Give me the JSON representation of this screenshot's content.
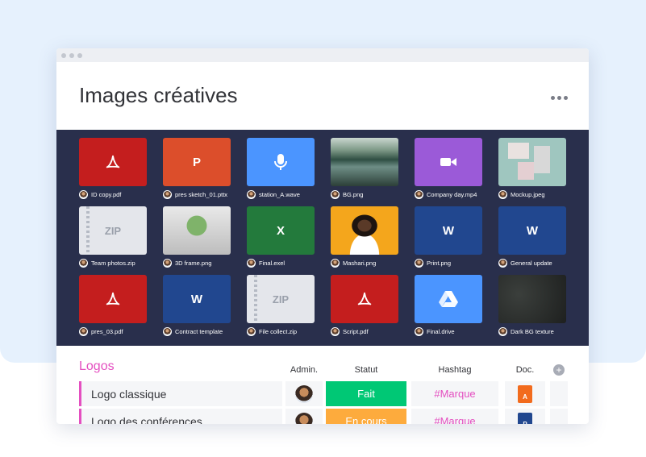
{
  "window": {
    "title": "Images créatives"
  },
  "gallery": {
    "items": [
      {
        "name": "ID copy.pdf",
        "type": "pdf",
        "glyph": "pdf-icon",
        "color": "#c41e1e"
      },
      {
        "name": "pres sketch_01.pttx",
        "type": "ppt",
        "glyph": "P",
        "color": "#dc4e2b"
      },
      {
        "name": "station_A.wave",
        "type": "audio",
        "glyph": "microphone-icon",
        "color": "#4b95ff"
      },
      {
        "name": "BG.png",
        "type": "image",
        "glyph": "lake-landscape-photo",
        "color": "#3f6f5d"
      },
      {
        "name": "Company day.mp4",
        "type": "video",
        "glyph": "video-camera-icon",
        "color": "#9b5ad8"
      },
      {
        "name": "Mockup.jpeg",
        "type": "image",
        "glyph": "mockup-photo",
        "color": "#9fc6bf"
      },
      {
        "name": "Team photos.zip",
        "type": "zip",
        "glyph": "ZIP",
        "color": "#e4e6eb"
      },
      {
        "name": "3D frame.png",
        "type": "image",
        "glyph": "3d-render-photo",
        "color": "#d9d9d9"
      },
      {
        "name": "Final.exel",
        "type": "excel",
        "glyph": "X",
        "color": "#237a3c"
      },
      {
        "name": "Mashari.png",
        "type": "image",
        "glyph": "portrait-photo",
        "color": "#f4a61c"
      },
      {
        "name": "Print.png",
        "type": "word",
        "glyph": "W",
        "color": "#21478f"
      },
      {
        "name": "General update",
        "type": "word",
        "glyph": "W",
        "color": "#21478f"
      },
      {
        "name": "pres_03.pdf",
        "type": "pdf",
        "glyph": "pdf-icon",
        "color": "#c41e1e"
      },
      {
        "name": "Contract template",
        "type": "word",
        "glyph": "W",
        "color": "#21478f"
      },
      {
        "name": "File collect.zip",
        "type": "zip",
        "glyph": "ZIP",
        "color": "#e4e6eb"
      },
      {
        "name": "Script.pdf",
        "type": "pdf",
        "glyph": "pdf-icon",
        "color": "#c41e1e"
      },
      {
        "name": "Final.drive",
        "type": "drive",
        "glyph": "drive-icon",
        "color": "#4b95ff"
      },
      {
        "name": "Dark BG texture",
        "type": "image",
        "glyph": "dark-texture-photo",
        "color": "#2b2e2c"
      }
    ]
  },
  "board": {
    "group_title": "Logos",
    "columns": {
      "admin": "Admin.",
      "statut": "Statut",
      "hashtag": "Hashtag",
      "doc": "Doc."
    },
    "rows": [
      {
        "name": "Logo classique",
        "status": "Fait",
        "status_color": "#00c875",
        "hashtag": "#Marque",
        "doc_letter": "A",
        "doc_color": "#f26b1d"
      },
      {
        "name": "Logo des conférences",
        "status": "En cours",
        "status_color": "#fdab3d",
        "hashtag": "#Marque",
        "doc_letter": "P",
        "doc_color": "#21478f"
      }
    ]
  },
  "colors": {
    "accent": "#e44fc0",
    "gallery_bg": "#292f4c",
    "page_bg": "#e6f1fd"
  }
}
